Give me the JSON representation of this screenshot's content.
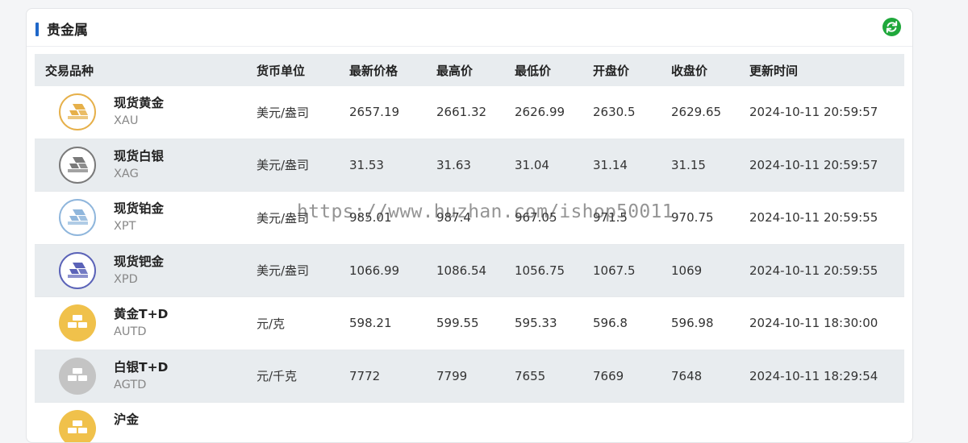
{
  "panel": {
    "title": "贵金属",
    "accent_color": "#1f67c9",
    "refresh_color": "#1fa83b",
    "refresh_icon": "refresh-icon"
  },
  "table": {
    "headers": [
      "交易品种",
      "货币单位",
      "最新价格",
      "最高价",
      "最低价",
      "开盘价",
      "收盘价",
      "更新时间"
    ],
    "rows": [
      {
        "name": "现货黄金",
        "code": "XAU",
        "unit": "美元/盎司",
        "latest": "2657.19",
        "high": "2661.32",
        "low": "2626.99",
        "open": "2630.5",
        "close": "2629.65",
        "time": "2024-10-11 20:59:57",
        "icon": "gold-bars-icon",
        "icon_color": "#e6b04a",
        "icon_style": "outline"
      },
      {
        "name": "现货白银",
        "code": "XAG",
        "unit": "美元/盎司",
        "latest": "31.53",
        "high": "31.63",
        "low": "31.04",
        "open": "31.14",
        "close": "31.15",
        "time": "2024-10-11 20:59:57",
        "icon": "silver-bars-icon",
        "icon_color": "#7a7a7a",
        "icon_style": "outline"
      },
      {
        "name": "现货铂金",
        "code": "XPT",
        "unit": "美元/盎司",
        "latest": "985.01",
        "high": "987.4",
        "low": "967.05",
        "open": "971.5",
        "close": "970.75",
        "time": "2024-10-11 20:59:55",
        "icon": "platinum-bars-icon",
        "icon_color": "#8fb6dc",
        "icon_style": "outline"
      },
      {
        "name": "现货钯金",
        "code": "XPD",
        "unit": "美元/盎司",
        "latest": "1066.99",
        "high": "1086.54",
        "low": "1056.75",
        "open": "1067.5",
        "close": "1069",
        "time": "2024-10-11 20:59:55",
        "icon": "palladium-bars-icon",
        "icon_color": "#5b63b8",
        "icon_style": "outline"
      },
      {
        "name": "黄金T+D",
        "code": "AUTD",
        "unit": "元/克",
        "latest": "598.21",
        "high": "599.55",
        "low": "595.33",
        "open": "596.8",
        "close": "596.98",
        "time": "2024-10-11 18:30:00",
        "icon": "gold-bars-icon",
        "icon_color": "#f0c14b",
        "icon_style": "filled"
      },
      {
        "name": "白银T+D",
        "code": "AGTD",
        "unit": "元/千克",
        "latest": "7772",
        "high": "7799",
        "low": "7655",
        "open": "7669",
        "close": "7648",
        "time": "2024-10-11 18:29:54",
        "icon": "silver-bars-icon",
        "icon_color": "#c4c4c4",
        "icon_style": "filled"
      },
      {
        "name": "沪金",
        "code": "",
        "unit": "",
        "latest": "",
        "high": "",
        "low": "",
        "open": "",
        "close": "",
        "time": "",
        "icon": "gold-bars-icon",
        "icon_color": "#f0c14b",
        "icon_style": "filled"
      }
    ]
  },
  "watermark": "https://www.huzhan.com/ishop50011"
}
